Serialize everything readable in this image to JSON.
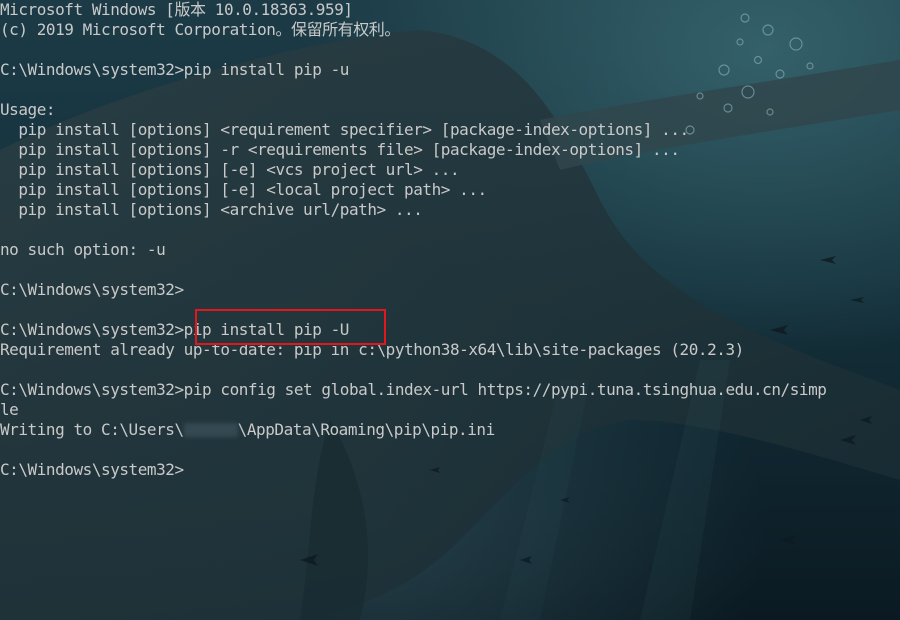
{
  "window": {
    "lines": [
      "Microsoft Windows [版本 10.0.18363.959]",
      "(c) 2019 Microsoft Corporation。保留所有权利。",
      "",
      "C:\\Windows\\system32>pip install pip -u",
      "",
      "Usage:",
      "  pip install [options] <requirement specifier> [package-index-options] ...",
      "  pip install [options] -r <requirements file> [package-index-options] ...",
      "  pip install [options] [-e] <vcs project url> ...",
      "  pip install [options] [-e] <local project path> ...",
      "  pip install [options] <archive url/path> ...",
      "",
      "no such option: -u",
      "",
      "C:\\Windows\\system32>",
      "",
      "C:\\Windows\\system32>pip install pip -U",
      "Requirement already up-to-date: pip in c:\\python38-x64\\lib\\site-packages (20.2.3)",
      "",
      "C:\\Windows\\system32>pip config set global.index-url https://pypi.tuna.tsinghua.edu.cn/simp",
      "le",
      "",
      "C:\\Windows\\system32>"
    ],
    "writing_line": {
      "before": "Writing to C:\\Users\\",
      "after": "\\AppData\\Roaming\\pip\\pip.ini"
    }
  },
  "colors": {
    "text": "#c9c9c9",
    "highlight_box": "#e0181b",
    "background": "#0d1e27"
  }
}
